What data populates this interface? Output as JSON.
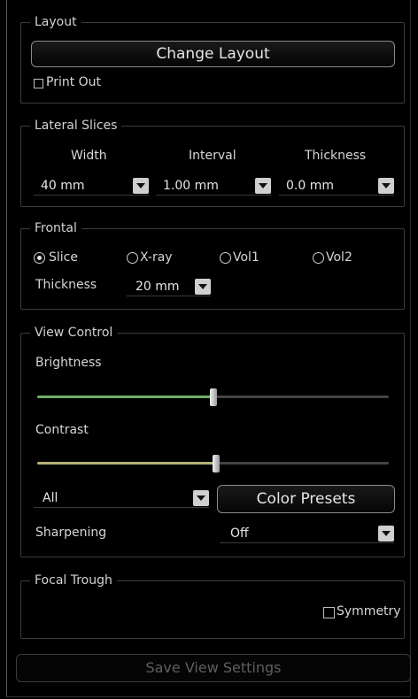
{
  "layout": {
    "legend": "Layout",
    "change_layout_label": "Change Layout",
    "print_out_label": "Print Out",
    "print_out_checked": false
  },
  "lateral_slices": {
    "legend": "Lateral Slices",
    "width_label": "Width",
    "interval_label": "Interval",
    "thickness_label": "Thickness",
    "width_value": "40 mm",
    "interval_value": "1.00 mm",
    "thickness_value": "0.0 mm"
  },
  "frontal": {
    "legend": "Frontal",
    "options": [
      "Slice",
      "X-ray",
      "Vol1",
      "Vol2"
    ],
    "selected": "Slice",
    "thickness_label": "Thickness",
    "thickness_value": "20 mm"
  },
  "view_control": {
    "legend": "View Control",
    "brightness_label": "Brightness",
    "brightness_value": 0.5,
    "contrast_label": "Contrast",
    "contrast_value": 0.51,
    "brightness_color": "#6fae6a",
    "contrast_color": "#b8b27a",
    "channel_value": "All",
    "color_presets_label": "Color Presets",
    "sharpening_label": "Sharpening",
    "sharpening_value": "Off"
  },
  "focal_trough": {
    "legend": "Focal Trough",
    "symmetry_label": "Symmetry",
    "symmetry_checked": false
  },
  "footer": {
    "save_label": "Save View Settings"
  }
}
